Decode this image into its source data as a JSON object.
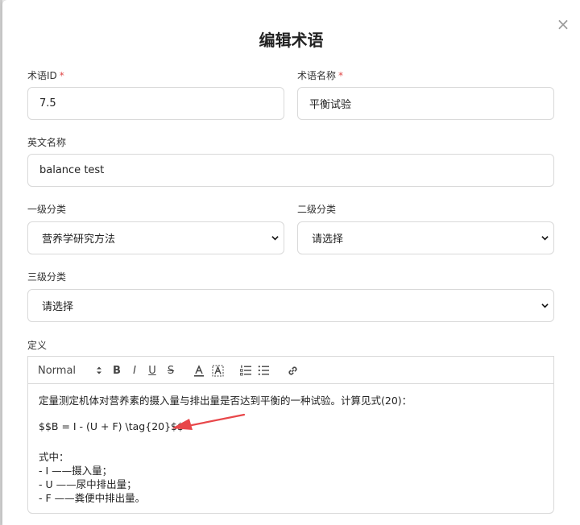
{
  "dialog": {
    "title": "编辑术语",
    "close_glyph": "×"
  },
  "form": {
    "term_id": {
      "label": "术语ID",
      "required_mark": "*",
      "value": "7.5"
    },
    "term_name": {
      "label": "术语名称",
      "required_mark": "*",
      "value": "平衡试验"
    },
    "english_name": {
      "label": "英文名称",
      "value": "balance test"
    },
    "level1": {
      "label": "一级分类",
      "selected": "营养学研究方法"
    },
    "level2": {
      "label": "二级分类",
      "selected": "请选择"
    },
    "level3": {
      "label": "三级分类",
      "selected": "请选择"
    },
    "definition": {
      "label": "定义"
    }
  },
  "toolbar": {
    "format_select": "Normal",
    "bold": "B",
    "italic": "I",
    "underline": "U",
    "strike": "S"
  },
  "editor": {
    "lines": [
      "定量测定机体对营养素的摄入量与排出量是否达到平衡的一种试验。计算见式(20)：",
      "$$B = I - (U + F) \\tag{20}$$",
      "式中：",
      "- I ——摄入量；",
      "- U ——尿中排出量；",
      "- F ——粪便中排出量。"
    ]
  },
  "colors": {
    "required": "#e04848",
    "annotation_arrow": "#e8474a",
    "border": "#d9d9d9"
  },
  "icons": {
    "close": "close-icon",
    "format_select_arrow": "updown-chevron-icon",
    "color": "text-color-icon",
    "background": "text-background-icon",
    "ordered_list": "ordered-list-icon",
    "bullet_list": "bullet-list-icon",
    "link": "link-icon",
    "select_chevron": "chevron-down-icon"
  }
}
